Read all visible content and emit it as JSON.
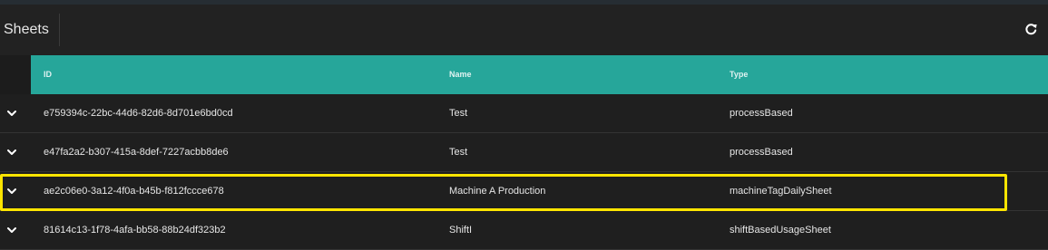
{
  "header": {
    "title": "Sheets",
    "refresh_icon": "refresh-icon"
  },
  "table": {
    "columns": [
      "ID",
      "Name",
      "Type"
    ],
    "header_color": "#26a69a",
    "rows": [
      {
        "id": "e759394c-22bc-44d6-82d6-8d701e6bd0cd",
        "name": "Test",
        "type": "processBased"
      },
      {
        "id": "e47fa2a2-b307-415a-8def-7227acbb8de6",
        "name": "Test",
        "type": "processBased"
      },
      {
        "id": "ae2c06e0-3a12-4f0a-b45b-f812fccce678",
        "name": "Machine A Production",
        "type": "machineTagDailySheet",
        "highlighted": true
      },
      {
        "id": "81614c13-1f78-4afa-bb58-88b24df323b2",
        "name": "ShiftI",
        "type": "shiftBasedUsageSheet"
      }
    ],
    "expand_icon": "chevron-down-icon",
    "highlight_color": "#ffe500"
  }
}
